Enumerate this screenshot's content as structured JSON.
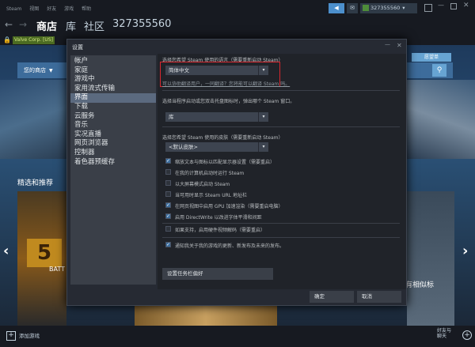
{
  "menu": {
    "items": [
      "Steam",
      "视图",
      "好友",
      "游戏",
      "帮助"
    ]
  },
  "account": {
    "name": "327355560",
    "points_icon": "megaphone-icon"
  },
  "nav": {
    "back": "←",
    "forward": "→",
    "store": "商店",
    "library": "库",
    "community": "社区",
    "profile": "327355560"
  },
  "urlbar": {
    "cert": "Valve Corp. [US]",
    "url": "https://store.steampowered.com/"
  },
  "store": {
    "your_store": "您的商店",
    "wishlist": "愿望单",
    "featured": "精选和推荐",
    "game_label": "BATT",
    "right_tag": "有相似标",
    "title_text": "5"
  },
  "bottom": {
    "add_game": "添加游戏",
    "friends": "好友与\n聊天"
  },
  "dialog": {
    "title": "设置",
    "nav": [
      "帐户",
      "家庭",
      "游戏中",
      "家用流式传输",
      "界面",
      "下载",
      "云服务",
      "音乐",
      "实况直播",
      "网页浏览器",
      "控制器",
      "着色器预缓存"
    ],
    "active_index": 4,
    "language_label": "选择您希望 Steam 使用的语言（需要重新启动 Steam）",
    "language_value": "简体中文",
    "help_link": "可以协助翻译用户，一同翻译？您将能可以翻译 Steam 吗。",
    "startwin_label": "选择当程序启动或您双击托盘图标时，弹出哪个 Steam 窗口。",
    "startwin_value": "库",
    "skin_label": "选择您希望 Steam 使用的皮肤（需要重新启动 Steam）",
    "skin_value": "<默认皮肤>",
    "options": [
      {
        "label": "缩放文本与图标以匹配显示器设置（需要重启）",
        "checked": true
      },
      {
        "label": "在我的计算机启动时运行 Steam",
        "checked": false
      },
      {
        "label": "以大屏幕模式启动 Steam",
        "checked": false
      },
      {
        "label": "当可用时显示 Steam URL 地址栏",
        "checked": false
      },
      {
        "label": "在网页视图中启用 GPU 加速渲染（需要重启电脑）",
        "checked": true
      },
      {
        "label": "启用 DirectWrite 以改进字体平滑和间距",
        "checked": true
      },
      {
        "label": "如果支持，启用硬件视频解码（需要重启）",
        "checked": false
      },
      {
        "label": "通知我关于我的游戏的更新、新发布及未来的发布。",
        "checked": true
      }
    ],
    "taskbar_button": "设置任务栏偏好",
    "ok": "确定",
    "cancel": "取消"
  },
  "colors": {
    "highlight": "#d9272e",
    "accent": "#66c0f4",
    "dialog_bg": "#262a33"
  }
}
